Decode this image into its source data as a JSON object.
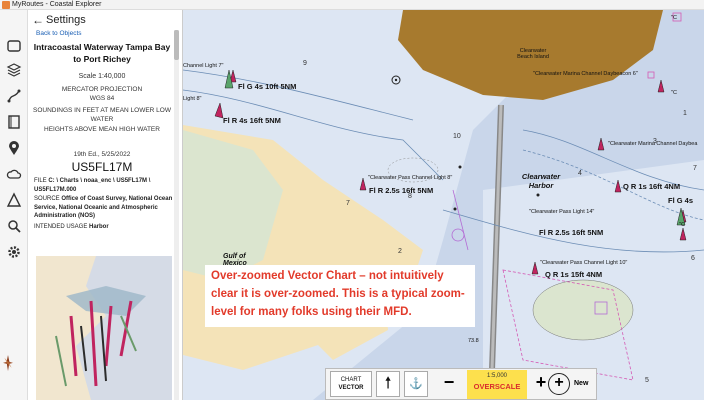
{
  "window": {
    "title": "MyRoutes - Coastal Explorer"
  },
  "rail": {
    "icons": [
      "panel-icon",
      "layers-icon",
      "route-icon",
      "book-icon",
      "marker-icon",
      "weather-icon",
      "triangle-icon",
      "search-icon",
      "settings-icon"
    ]
  },
  "settings": {
    "header": "Settings",
    "back_link": "Back to Objects",
    "chart_name": "Intracoastal Waterway Tampa Bay to Port Richey",
    "scale": "Scale 1:40,000",
    "projection": "MERCATOR PROJECTION",
    "datum": "WGS 84",
    "soundings": "SOUNDINGS IN FEET AT MEAN LOWER LOW WATER",
    "heights": "HEIGHTS ABOVE MEAN HIGH WATER",
    "edition": "19th Ed., 5/25/2022",
    "chart_id": "US5FL17M",
    "file_label": "FILE",
    "file_value": "C: \\ Charts \\ noaa_enc \\ US5FL17M \\ US5FL17M.000",
    "source_label": "SOURCE",
    "source_value": "Office of Coast Survey, National Ocean Service, National Oceanic and Atmospheric Administration (NOS)",
    "usage_label": "INTENDED USAGE",
    "usage_value": "Harbor"
  },
  "chart": {
    "labels": {
      "channel_light_7": "Channel Light 7\"",
      "fl_g_4s": "Fl G 4s 10ft 5NM",
      "light_8": "Light 8\"",
      "fl_r_4s": "Fl R 4s 16ft 5NM",
      "beach": "Clearwater Beach Island",
      "marina_db6": "\"Clearwater Marina Channel Daybeacon 6\"",
      "marina_db_right": "\"Clearwater Marina Channel Daybea",
      "c_right_top": "\"C",
      "c_right_mid": "\"C",
      "c_right_low": "\"C",
      "pass_light_8": "\"Clearwater Pass Channel Light 8\"",
      "fl_r_25": "Fl R 2.5s 16ft 5NM",
      "harbor": "Clearwater Harbor",
      "q_r_1s_4nm": "Q R 1s 16ft 4NM",
      "fl_g_right": "Fl G 4s",
      "pass_light_14": "\"Clearwater Pass Light 14\"",
      "fl_r_25_b": "Fl R 2.5s 16ft 5NM",
      "pass_light_10": "\"Clearwater Pass Channel Light 10\"",
      "q_r_1s_15": "Q R 1s 15ft 4NM",
      "gulf": "Gulf of Mexico",
      "d9": "9",
      "d10": "10",
      "d8": "8",
      "d7": "7",
      "d4": "4",
      "d3": "3",
      "d2": "2",
      "d1": "1",
      "d5": "5",
      "d6": "6",
      "d7b": "7",
      "elev": "73.8"
    }
  },
  "annotation": {
    "text": "Over-zoomed Vector Chart – not intuitively clear it is over-zoomed. This is a typical zoom-level for many folks using their MFD."
  },
  "toolbar": {
    "chart_label": "CHART",
    "chart_mode": "VECTOR",
    "scale": "1:5,000",
    "overscale": "OVERSCALE",
    "minus": "−",
    "plus": "+",
    "new_label": "New"
  },
  "colors": {
    "land": "#f4e3b8",
    "sand": "#a77a2e",
    "shallow": "#c9d6ea",
    "deep": "#dde6f3",
    "overscale": "#fde04d",
    "annotation": "#e23a2a"
  }
}
